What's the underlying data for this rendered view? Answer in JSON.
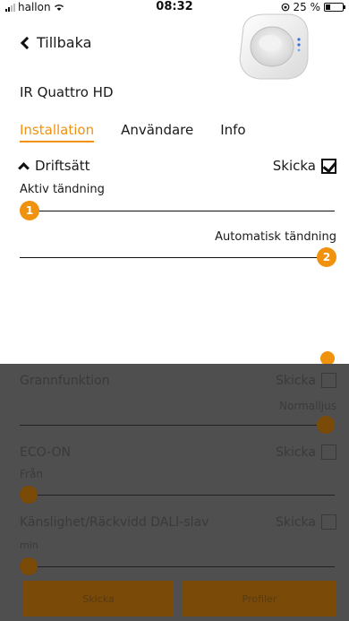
{
  "status": {
    "carrier": "hallon",
    "time": "08:32",
    "battery": "25 %"
  },
  "header": {
    "back_label": "Tillbaka",
    "device_name": "IR Quattro HD"
  },
  "tabs": [
    {
      "label": "Installation",
      "active": true
    },
    {
      "label": "Användare",
      "active": false
    },
    {
      "label": "Info",
      "active": false
    }
  ],
  "section": {
    "title": "Driftsätt",
    "send_label": "Skicka",
    "send_checked": true
  },
  "sliders": [
    {
      "label": "Aktiv tändning",
      "badge": "1",
      "value": 0
    },
    {
      "label": "Automatisk tändning",
      "badge": "2",
      "value": 1
    }
  ],
  "dimmed": {
    "rows": [
      {
        "title": "Grannfunktion",
        "send_label": "Skicka",
        "value_label": "Normalljus"
      },
      {
        "title": "ECO-ON",
        "send_label": "Skicka",
        "value_label": "Från"
      },
      {
        "title": "Känslighet/Räckvidd DALI-slav",
        "send_label": "Skicka",
        "value_label": "min"
      }
    ],
    "buttons": {
      "send": "Skicka",
      "profiles": "Profiler"
    }
  },
  "colors": {
    "accent": "#f0920e",
    "overlay": "#4f4f4f"
  }
}
